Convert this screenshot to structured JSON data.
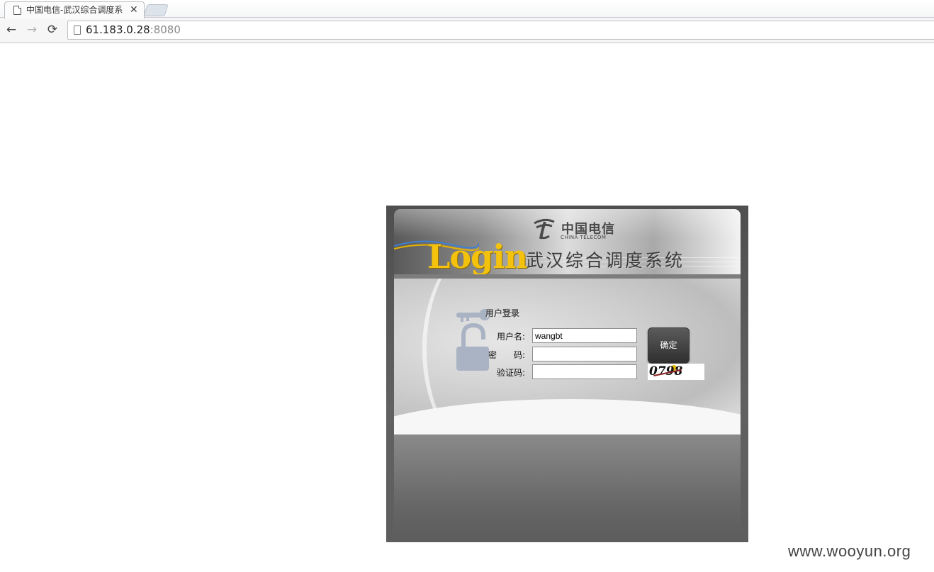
{
  "browser": {
    "tab_title": "中国电信-武汉综合调度系",
    "tab_close": "✕",
    "back_icon": "←",
    "forward_icon": "→",
    "reload_icon": "⟳",
    "url_host": "61.183.0.28",
    "url_port": ":8080"
  },
  "header": {
    "brand_cn": "中国电信",
    "brand_en": "CHINA TELECOM",
    "login_word": "Login",
    "system_title": "武汉综合调度系统"
  },
  "form": {
    "section_title": "用户登录",
    "username_label": "用户名:",
    "username_value": "wangbt",
    "password_label": "密　　码:",
    "password_value": "",
    "captcha_label": "验证码:",
    "captcha_value": "",
    "submit_label": "确定",
    "captcha_image_text": "0798"
  },
  "watermark": "www.wooyun.org",
  "colors": {
    "panel_dark": "#5e5e5e",
    "login_gold": "#f4c20d",
    "button_dark": "#2f2f2f"
  }
}
